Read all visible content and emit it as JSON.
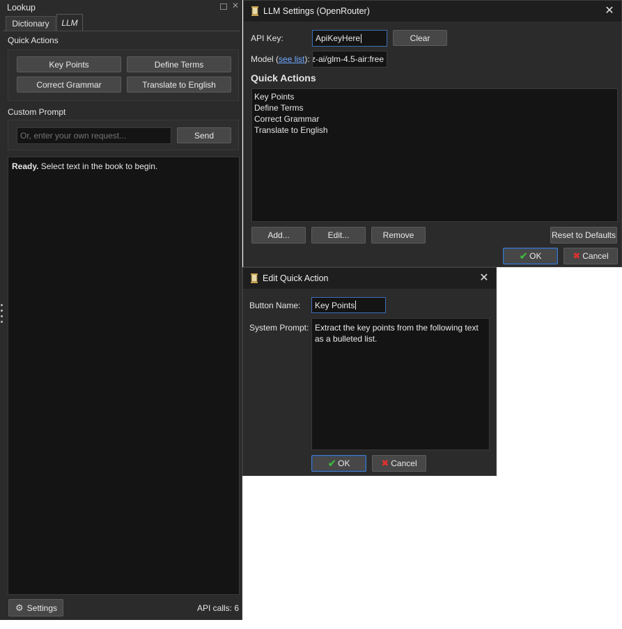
{
  "lookup": {
    "title": "Lookup",
    "tabs": [
      {
        "label": "Dictionary"
      },
      {
        "label": "LLM"
      }
    ],
    "quick_actions_heading": "Quick Actions",
    "quick_actions": [
      "Key Points",
      "Define Terms",
      "Correct Grammar",
      "Translate to English"
    ],
    "custom_prompt_heading": "Custom Prompt",
    "custom_prompt_placeholder": "Or, enter your own request...",
    "send_label": "Send",
    "status_bold": "Ready.",
    "status_text": " Select text in the book to begin.",
    "settings_label": "Settings",
    "api_calls": "API calls: 6"
  },
  "llm_settings": {
    "title": "LLM Settings (OpenRouter)",
    "api_key_label": "API Key:",
    "api_key_value": "ApiKeyHere",
    "clear_label": "Clear",
    "model_label_prefix": "Model (",
    "model_link": "see list",
    "model_label_suffix": "):",
    "model_value": "z-ai/glm-4.5-air:free",
    "quick_actions_heading": "Quick Actions",
    "quick_actions": [
      "Key Points",
      "Define Terms",
      "Correct Grammar",
      "Translate to English"
    ],
    "add_label": "Add...",
    "edit_label": "Edit...",
    "remove_label": "Remove",
    "reset_label": "Reset to Defaults",
    "ok_label": "OK",
    "cancel_label": "Cancel"
  },
  "edit_quick_action": {
    "title": "Edit Quick Action",
    "button_name_label": "Button Name:",
    "button_name_value": "Key Points",
    "system_prompt_label": "System Prompt:",
    "system_prompt_value": "Extract the key points from the following text as a bulleted list.",
    "ok_label": "OK",
    "cancel_label": "Cancel"
  },
  "colors": {
    "window_bg": "#2b2b2b",
    "field_bg": "#141414",
    "focus_border": "#3d6fb8",
    "link": "#6ea8ff",
    "ok_check": "#3cc23c",
    "cancel_x": "#e0302c"
  }
}
